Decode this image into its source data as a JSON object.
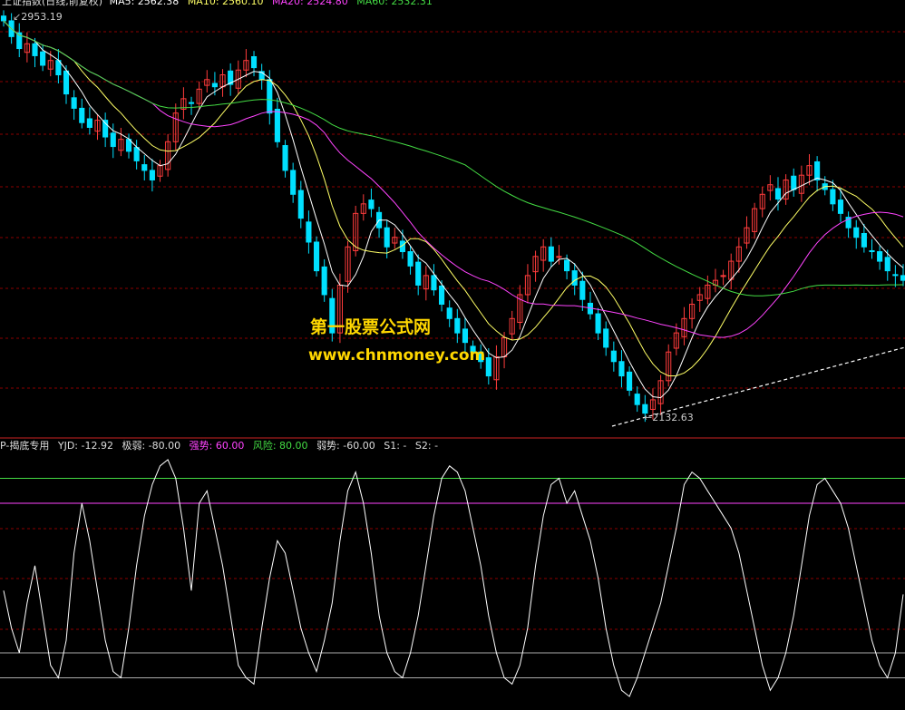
{
  "header": {
    "title": "上证指数(日线,前复权)",
    "ma5_label": "MA5: 2562.38",
    "ma10_label": "MA10: 2560.10",
    "ma20_label": "MA20: 2524.80",
    "ma60_label": "MA60: 2532.31"
  },
  "price_high_label": "2953.19",
  "price_low_label": "2132.63",
  "indicator": {
    "name": "P-揭底专用",
    "yjd": "YJD: -12.92",
    "jiruo": "极弱: -80.00",
    "qiangshi": "强势: 60.00",
    "fengxian": "风险: 80.00",
    "ruoshi": "弱势: -60.00",
    "s1": "S1: -",
    "s2": "S2: -"
  },
  "watermark": {
    "line1": "第一股票公式网",
    "line2": "www.chnmoney.com"
  },
  "colors": {
    "up": "#ff3c3c",
    "down": "#00e0ff",
    "ma5": "#ffffff",
    "ma10": "#ffff66",
    "ma20": "#ff44ff",
    "ma60": "#44dd44",
    "grid": "#8b0000",
    "strong_line": "#ff44ff",
    "risk_line": "#44dd44",
    "weak_line": "#aaaaaa",
    "indicator": "#ffffff"
  },
  "chart_data": [
    {
      "type": "candlestick",
      "title": "上证指数(日线,前复权)",
      "price_high": 2953.19,
      "price_low": 2132.63,
      "ylim": [
        2120,
        2970
      ],
      "close_series": [
        2953,
        2920,
        2895,
        2905,
        2880,
        2860,
        2870,
        2840,
        2800,
        2770,
        2740,
        2730,
        2745,
        2710,
        2690,
        2705,
        2680,
        2660,
        2640,
        2620,
        2650,
        2700,
        2760,
        2790,
        2780,
        2810,
        2830,
        2815,
        2840,
        2820,
        2850,
        2870,
        2855,
        2830,
        2760,
        2700,
        2640,
        2590,
        2540,
        2490,
        2430,
        2380,
        2300,
        2400,
        2480,
        2550,
        2570,
        2560,
        2520,
        2480,
        2500,
        2470,
        2440,
        2400,
        2420,
        2390,
        2360,
        2330,
        2300,
        2280,
        2260,
        2240,
        2210,
        2250,
        2290,
        2330,
        2380,
        2420,
        2460,
        2480,
        2450,
        2460,
        2430,
        2400,
        2370,
        2340,
        2300,
        2270,
        2240,
        2210,
        2180,
        2150,
        2132,
        2160,
        2200,
        2260,
        2300,
        2330,
        2360,
        2380,
        2400,
        2410,
        2420,
        2450,
        2480,
        2520,
        2560,
        2590,
        2610,
        2580,
        2620,
        2600,
        2630,
        2650,
        2620,
        2600,
        2570,
        2550,
        2520,
        2500,
        2480,
        2470,
        2450,
        2430,
        2420,
        2410
      ]
    },
    {
      "type": "line",
      "title": "P-揭底专用",
      "ylim": [
        -100,
        100
      ],
      "reference_lines": {
        "风险": 80,
        "强势": 60,
        "弱势": -60,
        "极弱": -80
      },
      "yjd_last": -12.92,
      "values": [
        -10,
        -40,
        -60,
        -20,
        10,
        -30,
        -70,
        -80,
        -50,
        20,
        60,
        30,
        -10,
        -50,
        -75,
        -80,
        -40,
        10,
        50,
        75,
        90,
        95,
        80,
        40,
        -10,
        60,
        70,
        40,
        10,
        -30,
        -70,
        -80,
        -85,
        -40,
        0,
        30,
        20,
        -10,
        -40,
        -60,
        -75,
        -50,
        -20,
        30,
        70,
        85,
        60,
        20,
        -30,
        -60,
        -75,
        -80,
        -60,
        -30,
        10,
        50,
        80,
        90,
        85,
        70,
        40,
        10,
        -30,
        -60,
        -80,
        -85,
        -70,
        -40,
        10,
        50,
        75,
        80,
        60,
        70,
        50,
        30,
        0,
        -40,
        -70,
        -90,
        -95,
        -80,
        -60,
        -40,
        -20,
        10,
        40,
        75,
        85,
        80,
        70,
        60,
        50,
        40,
        20,
        -10,
        -40,
        -70,
        -90,
        -80,
        -60,
        -30,
        10,
        50,
        75,
        80,
        70,
        60,
        40,
        10,
        -20,
        -50,
        -70,
        -80,
        -60,
        -13
      ]
    }
  ]
}
